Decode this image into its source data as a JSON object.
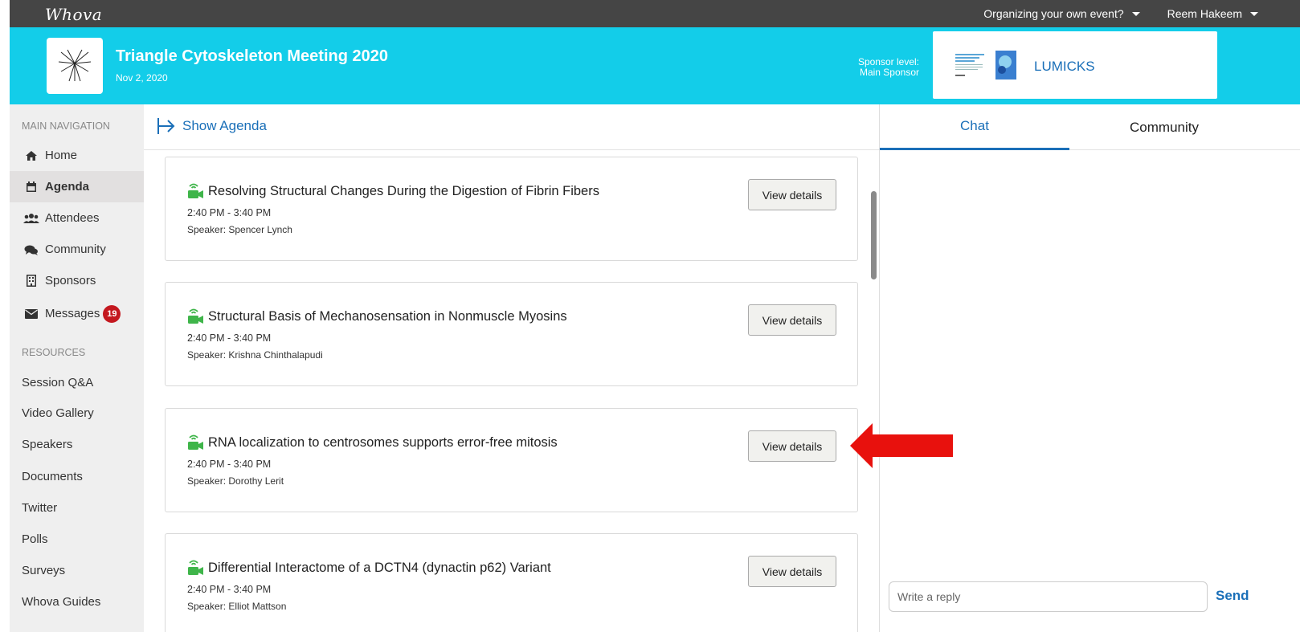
{
  "topbar": {
    "logo": "Whova",
    "organize_menu": "Organizing your own event?",
    "user_menu": "Reem Hakeem"
  },
  "header": {
    "event_title": "Triangle Cytoskeleton Meeting 2020",
    "event_date": "Nov 2, 2020",
    "sponsor_label_line1": "Sponsor level:",
    "sponsor_label_line2": "Main Sponsor",
    "sponsor_name": "LUMICKS"
  },
  "sidebar": {
    "main_nav_heading": "MAIN NAVIGATION",
    "nav_items": [
      {
        "label": "Home",
        "icon": "home-icon"
      },
      {
        "label": "Agenda",
        "icon": "calendar-icon"
      },
      {
        "label": "Attendees",
        "icon": "users-icon"
      },
      {
        "label": "Community",
        "icon": "comments-icon"
      },
      {
        "label": "Sponsors",
        "icon": "building-icon"
      },
      {
        "label": "Messages",
        "icon": "envelope-icon",
        "badge": "19"
      }
    ],
    "resources_heading": "RESOURCES",
    "resources": [
      "Session Q&A",
      "Video Gallery",
      "Speakers",
      "Documents",
      "Twitter",
      "Polls",
      "Surveys",
      "Whova Guides"
    ]
  },
  "agenda": {
    "show_agenda": "Show Agenda",
    "sessions": [
      {
        "title": "Resolving Structural Changes During the Digestion of Fibrin Fibers",
        "time": "2:40 PM - 3:40 PM",
        "speaker": "Speaker: Spencer Lynch",
        "button": "View details"
      },
      {
        "title": "Structural Basis of Mechanosensation in Nonmuscle Myosins",
        "time": "2:40 PM - 3:40 PM",
        "speaker": "Speaker: Krishna Chinthalapudi",
        "button": "View details"
      },
      {
        "title": "RNA localization to centrosomes supports error-free mitosis",
        "time": "2:40 PM - 3:40 PM",
        "speaker": "Speaker: Dorothy Lerit",
        "button": "View details"
      },
      {
        "title": "Differential Interactome of a DCTN4 (dynactin p62) Variant",
        "time": "2:40 PM - 3:40 PM",
        "speaker": "Speaker: Elliot Mattson",
        "button": "View details"
      }
    ]
  },
  "right_panel": {
    "tab_chat": "Chat",
    "tab_community": "Community",
    "reply_placeholder": "Write a reply",
    "send": "Send"
  },
  "colors": {
    "header_bg": "#13cde9",
    "topbar_bg": "#454545",
    "link_blue": "#1a6fb8",
    "badge_red": "#c4181f",
    "live_green": "#3fb54a",
    "annotation_arrow": "#e8110d"
  }
}
